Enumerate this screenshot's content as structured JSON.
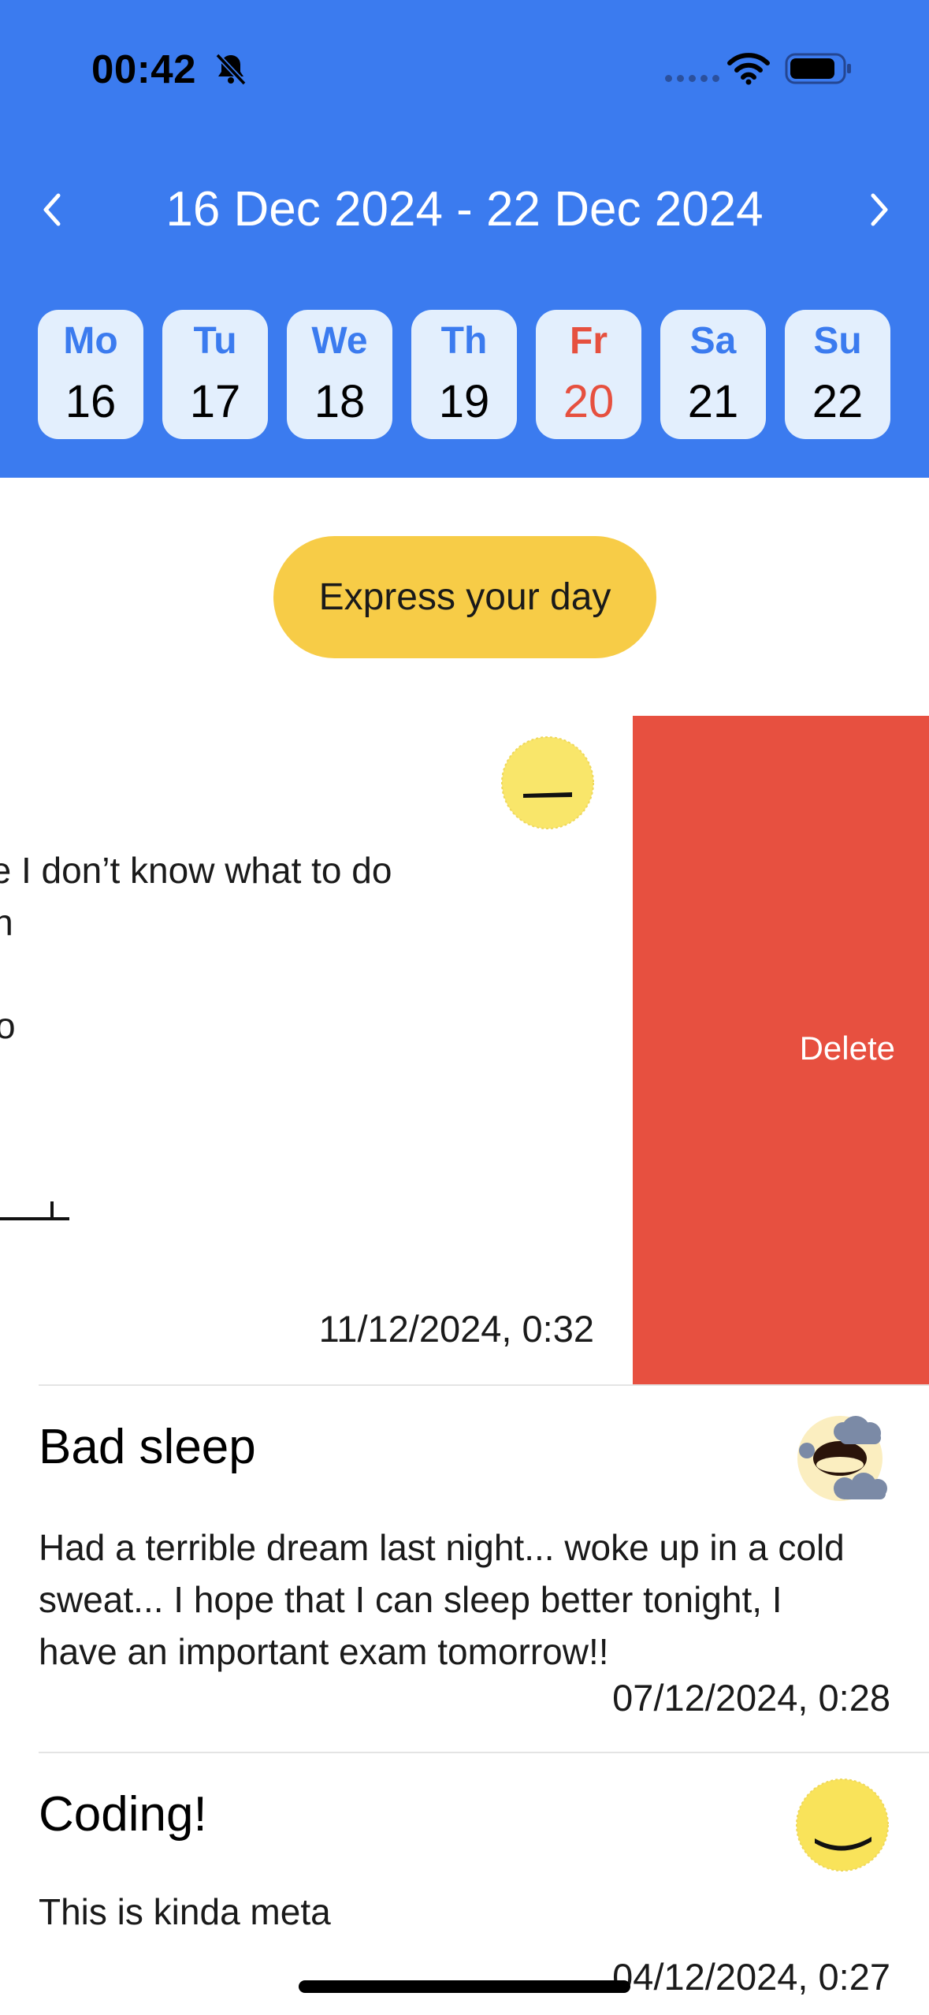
{
  "status_bar": {
    "time": "00:42",
    "icons": [
      "bell-slash-icon",
      "cellular-signal-icon",
      "wifi-icon",
      "battery-icon"
    ]
  },
  "week_nav": {
    "range": "16 Dec 2024 - 22 Dec 2024",
    "prev_icon": "chevron-left-icon",
    "next_icon": "chevron-right-icon",
    "days": [
      {
        "name": "Mo",
        "num": "16"
      },
      {
        "name": "Tu",
        "num": "17"
      },
      {
        "name": "We",
        "num": "18"
      },
      {
        "name": "Th",
        "num": "19"
      },
      {
        "name": "Fr",
        "num": "20",
        "today": true
      },
      {
        "name": "Sa",
        "num": "21"
      },
      {
        "name": "Su",
        "num": "22"
      }
    ]
  },
  "express_button": "Express your day",
  "swiped_entry": {
    "body_visible": "use I don’t know what to do\nugh",
    "partial_glyph": "o",
    "date": "11/12/2024, 0:32",
    "mood_icon": "neutral-face-icon",
    "delete_label": "Delete"
  },
  "entries": [
    {
      "title": "Bad sleep",
      "body": "Had a terrible dream last night... woke up in a cold sweat... I hope that I can sleep better tonight, I have an important exam tomorrow!!",
      "date": "07/12/2024, 0:28",
      "mood_icon": "stormy-face-icon"
    },
    {
      "title": "Coding!",
      "body": "This is kinda meta",
      "date": "04/12/2024, 0:27",
      "mood_icon": "smiling-face-icon"
    }
  ],
  "colors": {
    "header_blue": "#3b7bef",
    "day_bg": "#e3effd",
    "today_red": "#e6503f",
    "express_yellow": "#f7cc47",
    "delete_red": "#e75040"
  }
}
